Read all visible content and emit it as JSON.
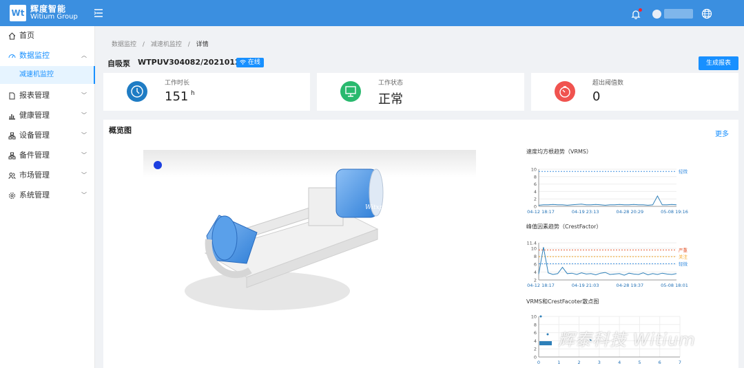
{
  "header": {
    "logo_mark": "Wt",
    "logo_title": "辉度智能",
    "logo_subtitle": "Witium Group"
  },
  "sidebar": {
    "items": [
      {
        "label": "首页"
      },
      {
        "label": "数据监控"
      },
      {
        "label": "减速机监控"
      },
      {
        "label": "报表管理"
      },
      {
        "label": "健康管理"
      },
      {
        "label": "设备管理"
      },
      {
        "label": "备件管理"
      },
      {
        "label": "市场管理"
      },
      {
        "label": "系统管理"
      }
    ]
  },
  "breadcrumb": {
    "items": [
      "数据监控",
      "/",
      "减速机监控",
      "/",
      "详情"
    ]
  },
  "device": {
    "name": "自吸泵",
    "code": "WTPUV304082/20210121",
    "status_badge": "在线",
    "report_button": "生成报表"
  },
  "stats": [
    {
      "label": "工作时长",
      "value": "151",
      "unit": "h",
      "color": "#1f7cc4"
    },
    {
      "label": "工作状态",
      "value": "正常",
      "unit": "",
      "color": "#29b96e"
    },
    {
      "label": "超出阈值数",
      "value": "0",
      "unit": "",
      "color": "#f0534f"
    }
  ],
  "overview": {
    "title": "概览图",
    "more": "更多",
    "model_brand": "Witxpert"
  },
  "charts": {
    "vrms": {
      "title": "速度均方根趋势（VRMS）",
      "ylim": [
        0,
        10
      ],
      "yticks": [
        "10",
        "8",
        "6",
        "4",
        "2",
        "0"
      ],
      "xticks": [
        "04-12 18:17",
        "04-19 23:13",
        "04-28 20:29",
        "05-08 19:16"
      ],
      "threshold_label": "轻微",
      "values": [
        0.3,
        0.4,
        0.4,
        0.5,
        0.4,
        0.4,
        0.3,
        0.4,
        0.5,
        0.6,
        0.4,
        0.4,
        0.5,
        0.4,
        0.3,
        0.4,
        0.4,
        0.5,
        0.4,
        0.4,
        0.5,
        0.4,
        0.4,
        0.3,
        0.4,
        2.8,
        0.4,
        0.4,
        0.5,
        0.4
      ]
    },
    "crest": {
      "title": "峰值因素趋势（CrestFactor）",
      "ylim": [
        2,
        11.4
      ],
      "yticks": [
        "11.4",
        "10",
        "8",
        "6",
        "4",
        "2"
      ],
      "xticks": [
        "04-12 18:17",
        "04-19 21:03",
        "04-28 19:37",
        "05-08 18:01"
      ],
      "thresholds": [
        "严重",
        "关注",
        "轻微"
      ],
      "threshold_colors": [
        "#e4572e",
        "#f5a623",
        "#3b8fe0"
      ],
      "values": [
        3.5,
        10.3,
        3.8,
        3.4,
        3.6,
        5.2,
        3.6,
        3.7,
        3.4,
        3.8,
        3.5,
        3.6,
        3.3,
        3.7,
        3.9,
        3.4,
        3.5,
        3.6,
        3.2,
        3.7,
        3.5,
        3.4,
        3.8,
        3.3,
        3.6,
        3.4,
        3.7,
        3.5,
        3.4,
        3.6
      ]
    },
    "scatter": {
      "title": "VRMS和CrestFacoter散点图",
      "yticks": [
        "10",
        "8",
        "6",
        "4",
        "2",
        "0"
      ],
      "xticks": [
        "0",
        "1",
        "2",
        "3",
        "4",
        "5",
        "6",
        "7"
      ]
    }
  },
  "watermark": "辉泰科技 Witium"
}
